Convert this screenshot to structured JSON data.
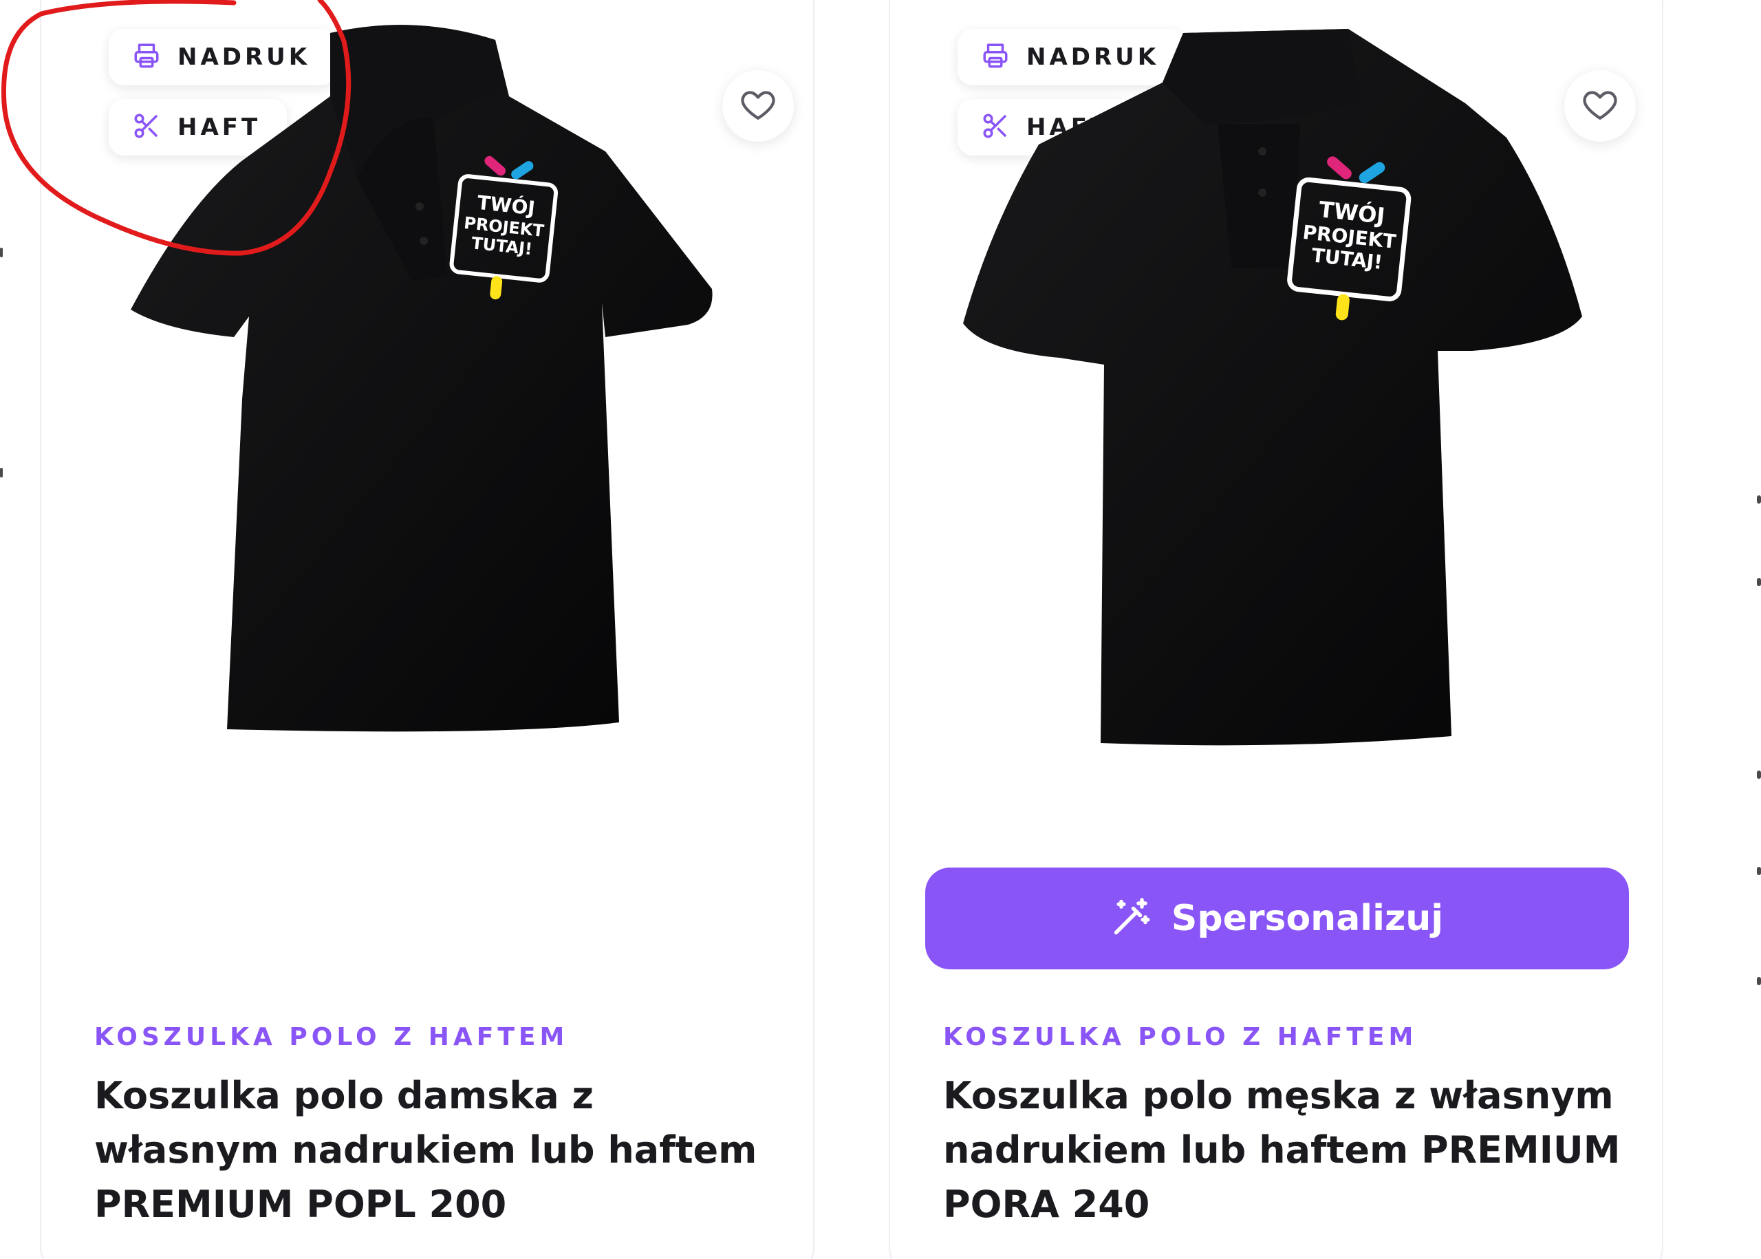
{
  "products": [
    {
      "tags": [
        {
          "label": "NADRUK",
          "icon": "printer-icon"
        },
        {
          "label": "HAFT",
          "icon": "scissors-icon"
        }
      ],
      "mockup_text": [
        "TWÓJ",
        "PROJEKT",
        "TUTAJ!"
      ],
      "category": "KOSZULKA POLO Z HAFTEM",
      "title": "Koszulka polo damska z własnym nadrukiem lub haftem PREMIUM POPL 200"
    },
    {
      "tags": [
        {
          "label": "NADRUK",
          "icon": "printer-icon"
        },
        {
          "label": "HAFT",
          "icon": "scissors-icon"
        }
      ],
      "mockup_text": [
        "TWÓJ",
        "PROJEKT",
        "TUTAJ!"
      ],
      "category": "KOSZULKA POLO Z HAFTEM",
      "title": "Koszulka polo męska z własnym nadrukiem lub haftem PREMIUM PORA 240",
      "button_label": "Spersonalizuj",
      "button_icon": "magic-wand-icon"
    }
  ],
  "colors": {
    "accent": "#8a55f7",
    "text": "#1b1b1f",
    "shirt": "#0b0b0c",
    "annotation": "#e11b1b",
    "logo_pink": "#e0267a",
    "logo_blue": "#1ea4e0",
    "logo_yellow": "#ffe31a"
  }
}
